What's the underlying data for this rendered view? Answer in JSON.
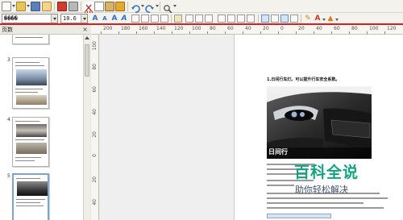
{
  "toolbar": {
    "font_name": "����",
    "font_size": "10.6",
    "icons": [
      "new-icon",
      "open-icon",
      "save-icon",
      "edit-icon",
      "pdf-icon",
      "print-icon",
      "cut-icon",
      "copy-icon",
      "paste-icon",
      "clone-icon",
      "undo-icon",
      "redo-icon",
      "zoom-icon"
    ],
    "accent": "#d61f1f"
  },
  "panel": {
    "title": "页数",
    "close_label": "×",
    "pages": [
      {
        "number": "3"
      },
      {
        "number": "4"
      },
      {
        "number": "5"
      }
    ]
  },
  "ruler": {
    "labels": [
      "200",
      "180",
      "160",
      "140",
      "120",
      "100",
      "80",
      "60",
      "40",
      "20",
      "0",
      "20",
      "40",
      "60",
      "80",
      "100",
      "120"
    ]
  },
  "document": {
    "heading": "1.日间行车灯。可以提升行车安全系数。",
    "photo_caption": "日间行"
  },
  "watermark": {
    "title": "百科全说",
    "subtitle": "助你轻松解决"
  }
}
